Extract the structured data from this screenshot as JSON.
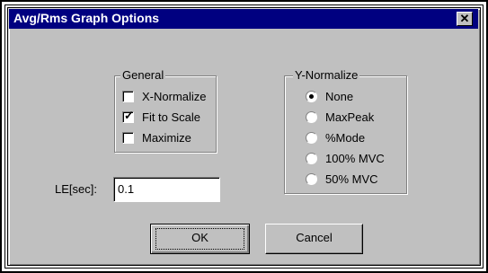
{
  "dialog": {
    "title": "Avg/Rms Graph Options",
    "close_label": "✕"
  },
  "general": {
    "label": "General",
    "options": [
      {
        "label": "X-Normalize",
        "checked": false
      },
      {
        "label": "Fit to Scale",
        "checked": true
      },
      {
        "label": "Maximize",
        "checked": false
      }
    ]
  },
  "y_normalize": {
    "label": "Y-Normalize",
    "options": [
      {
        "label": "None",
        "selected": true
      },
      {
        "label": "MaxPeak",
        "selected": false
      },
      {
        "label": "%Mode",
        "selected": false
      },
      {
        "label": "100% MVC",
        "selected": false
      },
      {
        "label": "50% MVC",
        "selected": false
      }
    ]
  },
  "le_field": {
    "label": "LE[sec]:",
    "value": "0.1"
  },
  "buttons": {
    "ok_label": "OK",
    "cancel_label": "Cancel"
  },
  "colors": {
    "titlebar": "#000080",
    "face": "#c0c0c0"
  }
}
